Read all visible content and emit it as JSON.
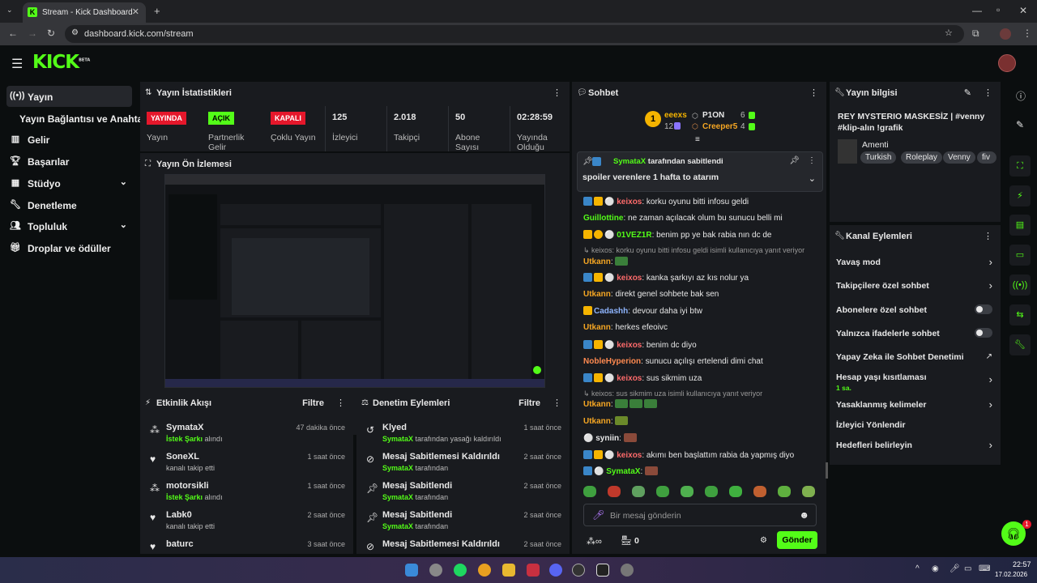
{
  "browser": {
    "tab_title": "Stream - Kick Dashboard",
    "url": "dashboard.kick.com/stream"
  },
  "app": {
    "logo": "KICK",
    "logo_sup": "BETA"
  },
  "sidebar": {
    "items": [
      {
        "label": "Yayın",
        "icon": "broadcast-icon"
      },
      {
        "label": "Yayın Bağlantısı ve Anahtarı"
      },
      {
        "label": "Gelir",
        "icon": "revenue-icon"
      },
      {
        "label": "Başarılar",
        "icon": "trophy-icon"
      },
      {
        "label": "Stüdyo",
        "icon": "studio-icon"
      },
      {
        "label": "Denetleme",
        "icon": "wrench-icon"
      },
      {
        "label": "Topluluk",
        "icon": "community-icon"
      },
      {
        "label": "Droplar ve ödüller",
        "icon": "gift-icon"
      }
    ]
  },
  "stats": {
    "title": "Yayın İstatistikleri",
    "items": [
      {
        "value": "YAYINDA",
        "label": "Yayın"
      },
      {
        "value": "AÇIK",
        "label": "Partnerlik Gelir"
      },
      {
        "value": "KAPALI",
        "label": "Çoklu Yayın"
      },
      {
        "value": "125",
        "label": "İzleyici"
      },
      {
        "value": "2.018",
        "label": "Takipçi"
      },
      {
        "value": "50",
        "label": "Abone Sayısı"
      },
      {
        "value": "02:28:59",
        "label": "Yayında Olduğu"
      }
    ]
  },
  "preview": {
    "title": "Yayın Ön İzlemesi"
  },
  "activity": {
    "title": "Etkinlik Akışı",
    "filter": "Filtre",
    "rows": [
      {
        "name": "SymataX",
        "sub_hl": "İstek Şarkı",
        "sub": "alındı",
        "time": "47 dakika önce"
      },
      {
        "name": "SoneXL",
        "sub_hl": "",
        "sub": "kanalı takip etti",
        "time": "1 saat önce"
      },
      {
        "name": "motorsikli",
        "sub_hl": "İstek Şarkı",
        "sub": "alındı",
        "time": "1 saat önce"
      },
      {
        "name": "Labk0",
        "sub_hl": "",
        "sub": "kanalı takip etti",
        "time": "2 saat önce"
      },
      {
        "name": "baturc",
        "sub_hl": "",
        "sub": "",
        "time": "3 saat önce"
      }
    ]
  },
  "moderation": {
    "title": "Denetim Eylemleri",
    "filter": "Filtre",
    "rows": [
      {
        "name": "Klyed",
        "sub_hl": "SymataX",
        "sub": "tarafından yasağı kaldırıldı",
        "time": "1 saat önce"
      },
      {
        "name": "Mesaj Sabitlemesi Kaldırıldı",
        "sub_hl": "SymataX",
        "sub": "tarafından",
        "time": "2 saat önce"
      },
      {
        "name": "Mesaj Sabitlendi",
        "sub_hl": "SymataX",
        "sub": "tarafından",
        "time": "2 saat önce"
      },
      {
        "name": "Mesaj Sabitlendi",
        "sub_hl": "SymataX",
        "sub": "tarafından",
        "time": "2 saat önce"
      },
      {
        "name": "Mesaj Sabitlemesi Kaldırıldı",
        "sub_hl": "",
        "sub": "",
        "time": "2 saat önce"
      }
    ]
  },
  "chat": {
    "title": "Sohbet",
    "leaders": [
      {
        "name": "eeexs",
        "count": "12"
      },
      {
        "name": "P1ON",
        "count": "6"
      },
      {
        "name": "Creeper5",
        "count": "4"
      }
    ],
    "pinned_by_user": "SymataX",
    "pinned_by_text": "tarafından sabitlendi",
    "pinned_message": "spoiler verenlere 1 hafta to atarım",
    "messages": [
      {
        "user": "keixos",
        "color": "#ff6b6b",
        "text": ": korku oyunu bitti infosu geldi"
      },
      {
        "user": "Guillottine",
        "color": "#53fc18",
        "text": ": ne zaman açılacak olum bu sunucu belli mi"
      },
      {
        "user": "01VEZ1R",
        "color": "#53fc18",
        "text": ": benim pp ye bak rabia nın dc de"
      },
      {
        "reply": "keixos: korku oyunu bitti infosu geldi isimli kullanıcıya yanıt veriyor"
      },
      {
        "user": "Utkann",
        "color": "#f5a623",
        "text": ":"
      },
      {
        "user": "keixos",
        "color": "#ff6b6b",
        "text": ": kanka şarkıyı az kıs nolur ya"
      },
      {
        "user": "Utkann",
        "color": "#f5a623",
        "text": ": direkt genel sohbete bak sen"
      },
      {
        "user": "Cadashh",
        "color": "#8fb5ff",
        "text": ": devour daha iyi btw"
      },
      {
        "user": "Utkann",
        "color": "#f5a623",
        "text": ": herkes efeoivc"
      },
      {
        "user": "keixos",
        "color": "#ff6b6b",
        "text": ": benim dc diyo"
      },
      {
        "user": "NobleHyperion",
        "color": "#ff8a50",
        "text": ": sunucu açılışı ertelendi dimi chat"
      },
      {
        "user": "keixos",
        "color": "#ff6b6b",
        "text": ": sus sikmim uza"
      },
      {
        "reply": "keixos: sus sikmim uza isimli kullanıcıya yanıt veriyor"
      },
      {
        "user": "Utkann",
        "color": "#f5a623",
        "text": ":"
      },
      {
        "user": "Utkann",
        "color": "#f5a623",
        "text": ":"
      },
      {
        "user": "syniin",
        "color": "#e8e8e8",
        "text": ":"
      },
      {
        "user": "keixos",
        "color": "#ff6b6b",
        "text": ": akımı ben başlattım rabia da yapmış diyo"
      },
      {
        "user": "SymataX",
        "color": "#53fc18",
        "text": ":"
      }
    ],
    "input_placeholder": "Bir mesaj gönderin",
    "points": "0",
    "send_label": "Gönder"
  },
  "stream_info": {
    "title": "Yayın bilgisi",
    "stream_title": "REY MYSTERIO MASKESİZ | #venny #klip-alın !grafik",
    "category": "Amenti",
    "tags": [
      "Turkish",
      "Roleplay",
      "Venny",
      "fiv"
    ]
  },
  "channel_actions": {
    "title": "Kanal Eylemleri",
    "items": [
      {
        "label": "Yavaş mod",
        "type": "chevron"
      },
      {
        "label": "Takipçilere özel sohbet",
        "type": "chevron"
      },
      {
        "label": "Abonelere özel sohbet",
        "type": "toggle"
      },
      {
        "label": "Yalnızca ifadelerle sohbet",
        "type": "toggle"
      },
      {
        "label": "Yapay Zeka ile Sohbet Denetimi",
        "type": "external"
      },
      {
        "label": "Hesap yaşı kısıtlaması",
        "sub": "1 sa.",
        "type": "chevron"
      },
      {
        "label": "Yasaklanmış kelimeler",
        "type": "chevron"
      },
      {
        "label": "İzleyici Yönlendir",
        "type": "none"
      },
      {
        "label": "Hedefleri belirleyin",
        "type": "chevron"
      }
    ]
  },
  "support_badge": "1",
  "taskbar": {
    "time": "22:57",
    "date": "17.02.2026"
  },
  "colors": {
    "accent": "#53fc18",
    "live": "#e5172b",
    "panel": "#191b1f",
    "bg": "#0b0e0f"
  }
}
